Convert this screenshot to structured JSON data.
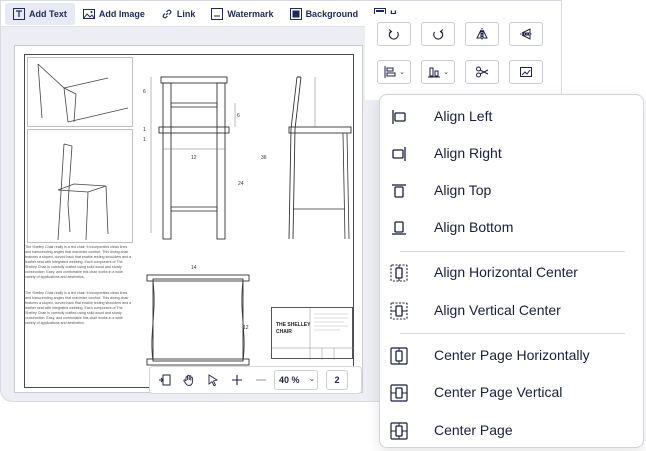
{
  "toolbar": {
    "items": [
      {
        "label": "Add Text",
        "icon": "text-icon"
      },
      {
        "label": "Add Image",
        "icon": "image-icon"
      },
      {
        "label": "Link",
        "icon": "link-icon"
      },
      {
        "label": "Watermark",
        "icon": "watermark-icon"
      },
      {
        "label": "Background",
        "icon": "background-icon"
      },
      {
        "label": "H",
        "icon": "header-icon"
      }
    ],
    "active_index": 0
  },
  "document": {
    "paragraph_1": "The Shelley Chair really is a red chair. It incorporates clean lines and transcending angles that maximize comfort. This dining chair features a sloped, curved back that enable resting shoulders and a leather seat with integrated webbing. Each component of The Shelley Chair is carefully crafted using solid wood and sturdy construction. Easy, and comfortable this chair works in a wide variety of applications and aesthetics.",
    "paragraph_2": "The Shelley Chair really is a red chair. It incorporates clean lines and transcending angles that maximize comfort. This dining chair features a sloped, curved back that enable resting shoulders and a leather seat with integrated webbing. Each component of The Shelley Chair is carefully crafted using solid wood and sturdy construction. Easy, and comfortable this chair works in a wide variety of applications and aesthetics.",
    "dimensions": {
      "d6a": "6",
      "d6b": "6",
      "d1a": "1",
      "d1b": "1",
      "d12": "12",
      "d36": "36",
      "d24": "24",
      "d14": "14",
      "d12b": "12"
    },
    "title_block": {
      "title_line1": "THE SHELLEY",
      "title_line2": "CHAIR"
    }
  },
  "bottom_bar": {
    "zoom_value": "40 %",
    "page_number": "2"
  },
  "tool_panel": {
    "buttons": [
      "rotate-left-icon",
      "rotate-right-icon",
      "flip-horizontal-icon",
      "flip-vertical-icon",
      "align-menu-icon",
      "distribute-menu-icon",
      "crop-icon",
      "image-replace-icon"
    ]
  },
  "align_menu": {
    "items": [
      {
        "label": "Align Left",
        "icon": "align-left-icon"
      },
      {
        "label": "Align Right",
        "icon": "align-right-icon"
      },
      {
        "label": "Align Top",
        "icon": "align-top-icon"
      },
      {
        "label": "Align Bottom",
        "icon": "align-bottom-icon"
      },
      {
        "label": "Align Horizontal Center",
        "icon": "align-horizontal-center-icon"
      },
      {
        "label": "Align Vertical Center",
        "icon": "align-vertical-center-icon"
      },
      {
        "label": "Center Page Horizontally",
        "icon": "center-page-horizontally-icon"
      },
      {
        "label": "Center Page Vertical",
        "icon": "center-page-vertical-icon"
      },
      {
        "label": "Center Page",
        "icon": "center-page-icon"
      }
    ]
  },
  "colors": {
    "accent": "#1e2a5a",
    "active_tab_bg": "#e7e9f4",
    "canvas_bg": "#eceef3"
  }
}
